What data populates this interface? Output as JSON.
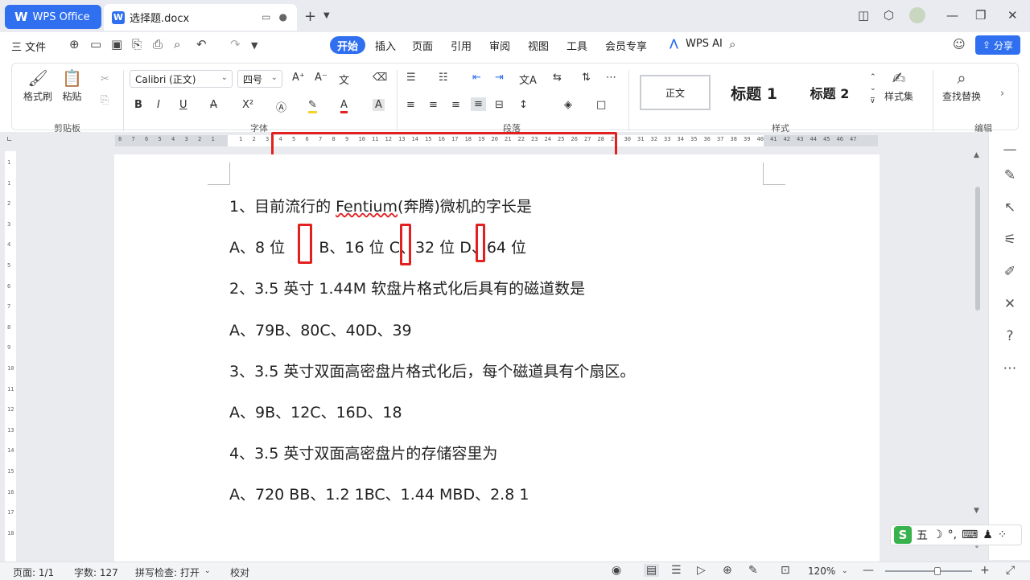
{
  "titlebar": {
    "app_name": "WPS Office",
    "app_logo": "W",
    "doc_tab": "选择题.docx",
    "doc_icon_letter": "W",
    "new_tab": "+",
    "minimize": "—",
    "restore": "❐",
    "close": "✕"
  },
  "menubar": {
    "file": "三 文件",
    "tabs": [
      "开始",
      "插入",
      "页面",
      "引用",
      "审阅",
      "视图",
      "工具",
      "会员专享",
      "WPS AI"
    ],
    "share": "分享"
  },
  "ribbon": {
    "clipboard": {
      "format_painter": "格式刷",
      "paste": "粘贴",
      "label": "剪贴板"
    },
    "font": {
      "name": "Calibri (正文)",
      "size": "四号",
      "label": "字体"
    },
    "paragraph": {
      "label": "段落"
    },
    "styles": {
      "normal": "正文",
      "h1": "标题 1",
      "h2": "标题 2",
      "style_set": "样式集",
      "label": "样式"
    },
    "edit": {
      "find_replace": "查找替换",
      "label": "编辑"
    }
  },
  "ruler": {
    "left_numbers": [
      "8",
      "7",
      "6",
      "5",
      "4",
      "3",
      "2",
      "1"
    ],
    "right_numbers": [
      "1",
      "2",
      "3",
      "4",
      "5",
      "6",
      "7",
      "8",
      "9",
      "10",
      "11",
      "12",
      "13",
      "14",
      "15",
      "16",
      "17",
      "18",
      "19",
      "20",
      "21",
      "22",
      "23",
      "24",
      "25",
      "26",
      "27",
      "28",
      "29",
      "30",
      "31",
      "32",
      "33",
      "34",
      "35",
      "36",
      "37",
      "38",
      "39",
      "40",
      "41",
      "42",
      "43",
      "44",
      "45",
      "46",
      "47"
    ]
  },
  "vruler_numbers": [
    "1",
    "1",
    "2",
    "3",
    "4",
    "5",
    "6",
    "7",
    "8",
    "9",
    "10",
    "11",
    "12",
    "13",
    "14",
    "15",
    "16",
    "17",
    "18"
  ],
  "document": {
    "lines": [
      {
        "pre": "1、目前流行的 ",
        "spell": "Fentium",
        "post": "(奔腾)微机的字长是"
      },
      {
        "text": "A、8 位       B、16 位 C、32 位 D、64 位"
      },
      {
        "text": "2、3.5 英寸 1.44M 软盘片格式化后具有的磁道数是"
      },
      {
        "text": "A、79B、80C、40D、39"
      },
      {
        "text": "3、3.5 英寸双面高密盘片格式化后，每个磁道具有个扇区。"
      },
      {
        "text": "A、9B、12C、16D、18"
      },
      {
        "text": "4、3.5 英寸双面高密盘片的存储容里为"
      },
      {
        "text": "A、720 BB、1.2 1BC、1.44 MBD、2.8 1"
      }
    ]
  },
  "ime": {
    "logo": "S",
    "mode": "五",
    "items": [
      "☽",
      "°,",
      "⌨",
      "♟",
      "⁘"
    ]
  },
  "statusbar": {
    "page": "页面: 1/1",
    "words": "字数: 127",
    "spell_check": "拼写检查: 打开",
    "proofread": "校对",
    "zoom": "120%",
    "zoom_level_percent": 60
  },
  "colors": {
    "accent": "#2f6ff0",
    "highlight_red": "#e22020"
  }
}
